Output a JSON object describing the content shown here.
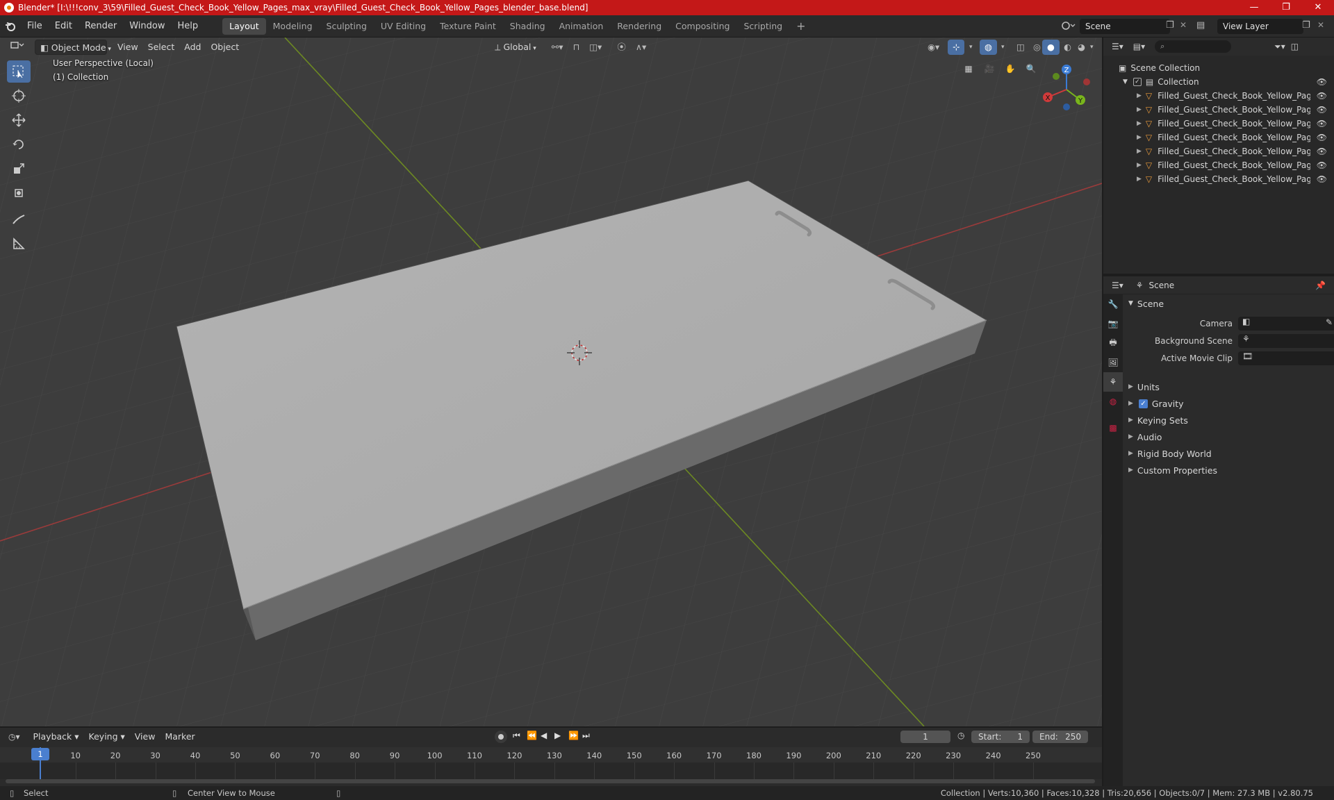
{
  "window": {
    "title": "Blender* [I:\\!!!conv_3\\59\\Filled_Guest_Check_Book_Yellow_Pages_max_vray\\Filled_Guest_Check_Book_Yellow_Pages_blender_base.blend]",
    "minimize": "—",
    "maximize": "❐",
    "close": "✕"
  },
  "menu": [
    "File",
    "Edit",
    "Render",
    "Window",
    "Help"
  ],
  "workspaces": [
    "Layout",
    "Modeling",
    "Sculpting",
    "UV Editing",
    "Texture Paint",
    "Shading",
    "Animation",
    "Rendering",
    "Compositing",
    "Scripting"
  ],
  "add_workspace": "+",
  "scene_name": "Scene",
  "view_layer": "View Layer",
  "viewport": {
    "mode": "Object Mode",
    "menus": [
      "View",
      "Select",
      "Add",
      "Object"
    ],
    "transform_orientation": "Global",
    "perspective_label": "User Perspective (Local)",
    "collection_label": "(1) Collection",
    "gizmo": {
      "x": "X",
      "y": "Y",
      "z": "Z"
    }
  },
  "outliner": {
    "root": "Scene Collection",
    "collection": "Collection",
    "items": [
      "Filled_Guest_Check_Book_Yellow_Pages_Blo",
      "Filled_Guest_Check_Book_Yellow_Pages_Car",
      "Filled_Guest_Check_Book_Yellow_Pages_She",
      "Filled_Guest_Check_Book_Yellow_Pages_She",
      "Filled_Guest_Check_Book_Yellow_Pages_She",
      "Filled_Guest_Check_Book_Yellow_Pages_Sta",
      "Filled_Guest_Check_Book_Yellow_Pages_Sta"
    ]
  },
  "properties": {
    "header": "Scene",
    "panel_title": "Scene",
    "camera_label": "Camera",
    "background_scene_label": "Background Scene",
    "active_movie_clip_label": "Active Movie Clip",
    "sections": [
      "Units",
      "Gravity",
      "Keying Sets",
      "Audio",
      "Rigid Body World",
      "Custom Properties"
    ],
    "gravity_checked": true
  },
  "timeline": {
    "menus": [
      "Playback",
      "Keying",
      "View",
      "Marker"
    ],
    "current_frame": "1",
    "start_label": "Start:",
    "start": "1",
    "end_label": "End:",
    "end": "250",
    "ticks": [
      "1",
      "10",
      "20",
      "30",
      "40",
      "50",
      "60",
      "70",
      "80",
      "90",
      "100",
      "110",
      "120",
      "130",
      "140",
      "150",
      "160",
      "170",
      "180",
      "190",
      "200",
      "210",
      "220",
      "230",
      "240",
      "250"
    ]
  },
  "status": {
    "select": "Select",
    "center": "Center View to Mouse",
    "stats": "Collection | Verts:10,360 | Faces:10,328 | Tris:20,656 | Objects:0/7 | Mem: 27.3 MB | v2.80.75"
  }
}
